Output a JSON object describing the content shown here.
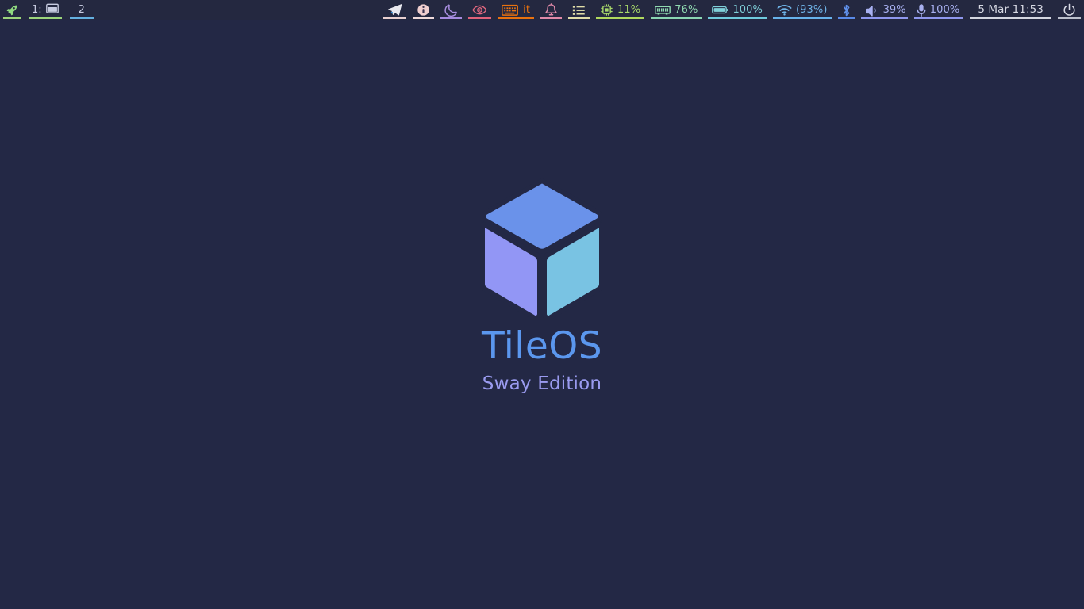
{
  "bar": {
    "background": "#242840",
    "launcher": {
      "icon": "rocket-icon",
      "color": "#8fd97f",
      "underline": "#9bd47b"
    },
    "workspaces": [
      {
        "label": "1:",
        "icon": "window-icon",
        "active": false,
        "underline": "#9bd47b",
        "color": "#c7cbe0"
      },
      {
        "label": "2",
        "icon": "",
        "active": true,
        "underline": "#64b0e0",
        "color": "#c7cbe0"
      }
    ],
    "tray": [
      {
        "name": "telegram-icon",
        "icon": "paper-plane-icon",
        "label": "",
        "color": "#e8e8ee",
        "underline": "#e8cfcf"
      },
      {
        "name": "info-icon",
        "icon": "info-circle-icon",
        "label": "",
        "color": "#f0c8c8",
        "underline": "#efdada"
      },
      {
        "name": "night-mode-icon",
        "icon": "moon-icon",
        "label": "",
        "color": "#a88ee0",
        "underline": "#a58ae0"
      },
      {
        "name": "eye-icon",
        "icon": "eye-icon",
        "label": "",
        "color": "#e0687f",
        "underline": "#e0627a"
      },
      {
        "name": "keyboard-layout",
        "icon": "keyboard-icon",
        "label": "it",
        "color": "#e8720f",
        "underline": "#e8720f"
      },
      {
        "name": "notifications",
        "icon": "bell-icon",
        "label": "",
        "color": "#e089a8",
        "underline": "#e089a8"
      },
      {
        "name": "tasklist-icon",
        "icon": "list-icon",
        "label": "",
        "color": "#e0dda8",
        "underline": "#e0dda8"
      },
      {
        "name": "cpu-module",
        "icon": "cpu-icon",
        "label": "11%",
        "color": "#a8d96a",
        "underline": "#b0d95e"
      },
      {
        "name": "memory-module",
        "icon": "memory-icon",
        "label": "76%",
        "color": "#8fd9b0",
        "underline": "#8ad6b2"
      },
      {
        "name": "battery-module",
        "icon": "battery-icon",
        "label": "100%",
        "color": "#7fd0d9",
        "underline": "#6fcbdd"
      },
      {
        "name": "network-module",
        "icon": "wifi-icon",
        "label": "(93%)",
        "color": "#6fb4e8",
        "underline": "#67b2ea"
      },
      {
        "name": "bluetooth-module",
        "icon": "bluetooth-icon",
        "label": "",
        "color": "#5f8fe8",
        "underline": "#5a8ae8"
      },
      {
        "name": "volume-module",
        "icon": "speaker-icon",
        "label": "39%",
        "color": "#a8b0f0",
        "underline": "#8f97ee"
      },
      {
        "name": "mic-module",
        "icon": "microphone-icon",
        "label": "100%",
        "color": "#a8b0f0",
        "underline": "#8f97ee"
      },
      {
        "name": "clock-module",
        "icon": "",
        "label": "5 Mar 11:53",
        "color": "#d8dae4",
        "underline": "#d4d6e0"
      },
      {
        "name": "power-module",
        "icon": "power-icon",
        "label": "",
        "color": "#d8dae4",
        "underline": "#bcc0cc"
      }
    ]
  },
  "desktop": {
    "background": "#232845",
    "logo": {
      "name": "tileos-cube-logo",
      "top_face_color": "#6a92ea",
      "left_face_color": "#9296f5",
      "right_face_color": "#79c3e3",
      "outline_color": "#232845"
    },
    "title": "TileOS",
    "title_color": "#5b97ee",
    "subtitle": "Sway Edition",
    "subtitle_color": "#9a9bf0"
  }
}
